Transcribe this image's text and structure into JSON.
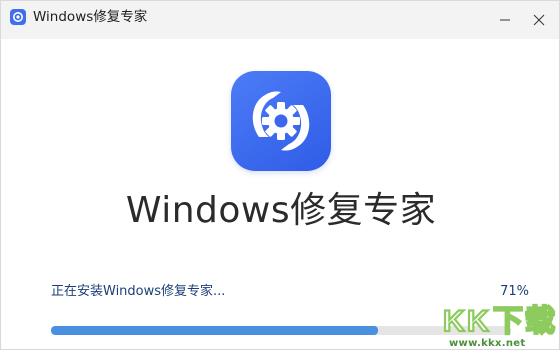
{
  "window": {
    "title": "Windows修复专家",
    "icon": "app-icon",
    "controls": [
      "minimize-icon",
      "close-icon"
    ]
  },
  "main": {
    "logo_icon": "gear-repair-icon",
    "app_name": "Windows修复专家"
  },
  "progress": {
    "status_text": "正在安装Windows修复专家...",
    "percent_text": "71%",
    "value": 0.71,
    "accent_color": "#4a8fe0"
  },
  "watermark": {
    "brand": "KK下载",
    "url": "www.kkx.net"
  }
}
